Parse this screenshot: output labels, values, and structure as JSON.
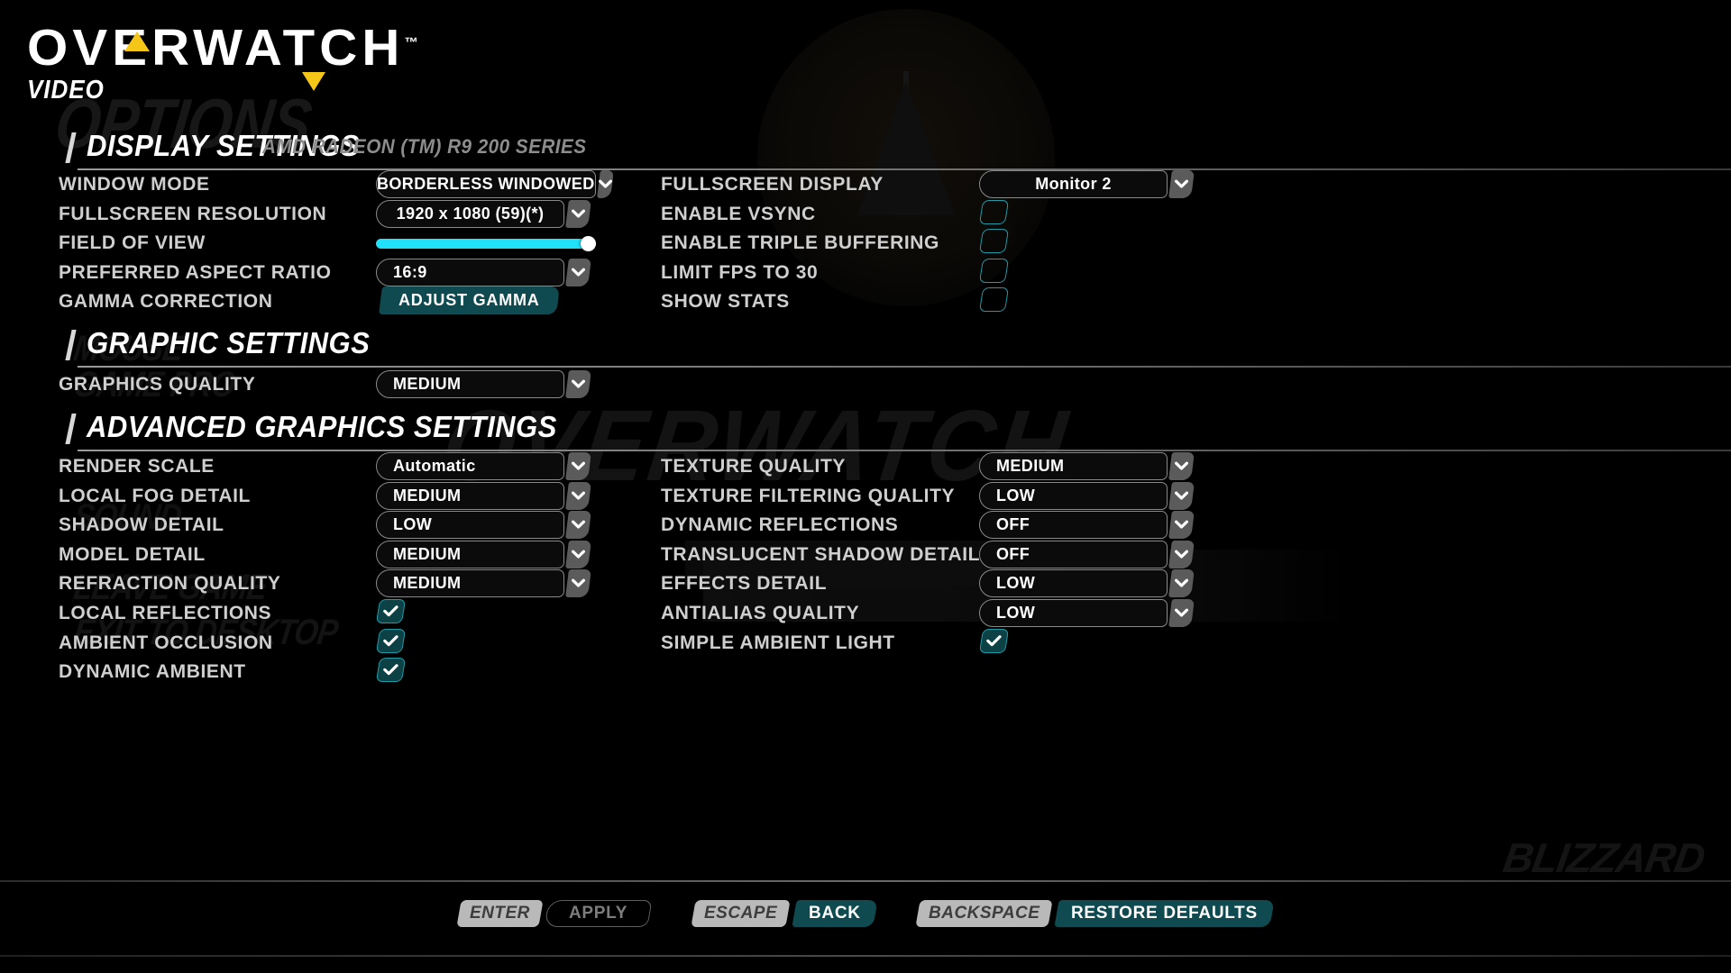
{
  "header": {
    "logo": "OVERWATCH",
    "tm": "™",
    "subtitle": "VIDEO",
    "ghost_options": "OPTIONS",
    "ghost_mouse": "MOUSE",
    "ghost_gamepro": "GAME PRO",
    "ghost_sound": "SOUND",
    "ghost_leave": "LEAVE GAME",
    "ghost_exit": "EXIT TO DESKTOP",
    "ghost_watermark": "OVERWATCH",
    "ghost_blizzard": "BLIZZARD"
  },
  "sections": [
    {
      "title": "DISPLAY SETTINGS",
      "gpu": "AMD RADEON (TM) R9 200 SERIES"
    },
    {
      "title": "GRAPHIC SETTINGS",
      "gpu": ""
    },
    {
      "title": "ADVANCED GRAPHICS SETTINGS",
      "gpu": ""
    }
  ],
  "display_settings": {
    "left": [
      {
        "label": "WINDOW MODE",
        "type": "dropdown",
        "value": "BORDERLESS WINDOWED",
        "align": "center"
      },
      {
        "label": "FULLSCREEN RESOLUTION",
        "type": "dropdown",
        "value": "1920 x 1080 (59)(*)",
        "align": "center"
      },
      {
        "label": "FIELD OF VIEW",
        "type": "slider",
        "value": "100",
        "percent": 100
      },
      {
        "label": "PREFERRED ASPECT RATIO",
        "type": "dropdown",
        "value": "16:9",
        "align": "left"
      },
      {
        "label": "GAMMA CORRECTION",
        "type": "button",
        "value": "ADJUST GAMMA"
      }
    ],
    "right": [
      {
        "label": "FULLSCREEN DISPLAY",
        "type": "dropdown",
        "value": "Monitor 2",
        "align": "center"
      },
      {
        "label": "ENABLE VSYNC",
        "type": "checkbox",
        "checked": false
      },
      {
        "label": "ENABLE TRIPLE BUFFERING",
        "type": "checkbox",
        "checked": false
      },
      {
        "label": "LIMIT FPS TO 30",
        "type": "checkbox",
        "checked": false
      },
      {
        "label": "SHOW STATS",
        "type": "checkbox",
        "checked": false
      }
    ]
  },
  "graphic_settings": {
    "left": [
      {
        "label": "GRAPHICS QUALITY",
        "type": "dropdown",
        "value": "MEDIUM",
        "align": "left"
      }
    ],
    "right": []
  },
  "advanced_graphics_settings": {
    "left": [
      {
        "label": "RENDER SCALE",
        "type": "dropdown",
        "value": "Automatic",
        "align": "left"
      },
      {
        "label": "LOCAL FOG DETAIL",
        "type": "dropdown",
        "value": "MEDIUM",
        "align": "left"
      },
      {
        "label": "SHADOW DETAIL",
        "type": "dropdown",
        "value": "LOW",
        "align": "left"
      },
      {
        "label": "MODEL DETAIL",
        "type": "dropdown",
        "value": "MEDIUM",
        "align": "left"
      },
      {
        "label": "REFRACTION QUALITY",
        "type": "dropdown",
        "value": "MEDIUM",
        "align": "left"
      },
      {
        "label": "LOCAL REFLECTIONS",
        "type": "checkbox",
        "checked": true
      },
      {
        "label": "AMBIENT OCCLUSION",
        "type": "checkbox",
        "checked": true
      },
      {
        "label": "DYNAMIC AMBIENT",
        "type": "checkbox",
        "checked": true
      }
    ],
    "right": [
      {
        "label": "TEXTURE QUALITY",
        "type": "dropdown",
        "value": "MEDIUM",
        "align": "left"
      },
      {
        "label": "TEXTURE FILTERING QUALITY",
        "type": "dropdown",
        "value": "LOW",
        "align": "left"
      },
      {
        "label": "DYNAMIC REFLECTIONS",
        "type": "dropdown",
        "value": "OFF",
        "align": "left"
      },
      {
        "label": "TRANSLUCENT SHADOW DETAIL",
        "type": "dropdown",
        "value": "OFF",
        "align": "left"
      },
      {
        "label": "EFFECTS DETAIL",
        "type": "dropdown",
        "value": "LOW",
        "align": "left"
      },
      {
        "label": "ANTIALIAS QUALITY",
        "type": "dropdown",
        "value": "LOW",
        "align": "left"
      },
      {
        "label": "SIMPLE AMBIENT LIGHT",
        "type": "checkbox",
        "checked": true
      }
    ]
  },
  "footer": [
    {
      "key": "ENTER",
      "action": "APPLY",
      "disabled": true
    },
    {
      "key": "ESCAPE",
      "action": "BACK",
      "disabled": false
    },
    {
      "key": "BACKSPACE",
      "action": "RESTORE DEFAULTS",
      "disabled": false
    }
  ],
  "colors": {
    "accent_cyan": "#21e0fa",
    "teal_fill": "#0e4a4f",
    "teal_border": "#1f9aa6",
    "yellow": "#f5c518"
  }
}
